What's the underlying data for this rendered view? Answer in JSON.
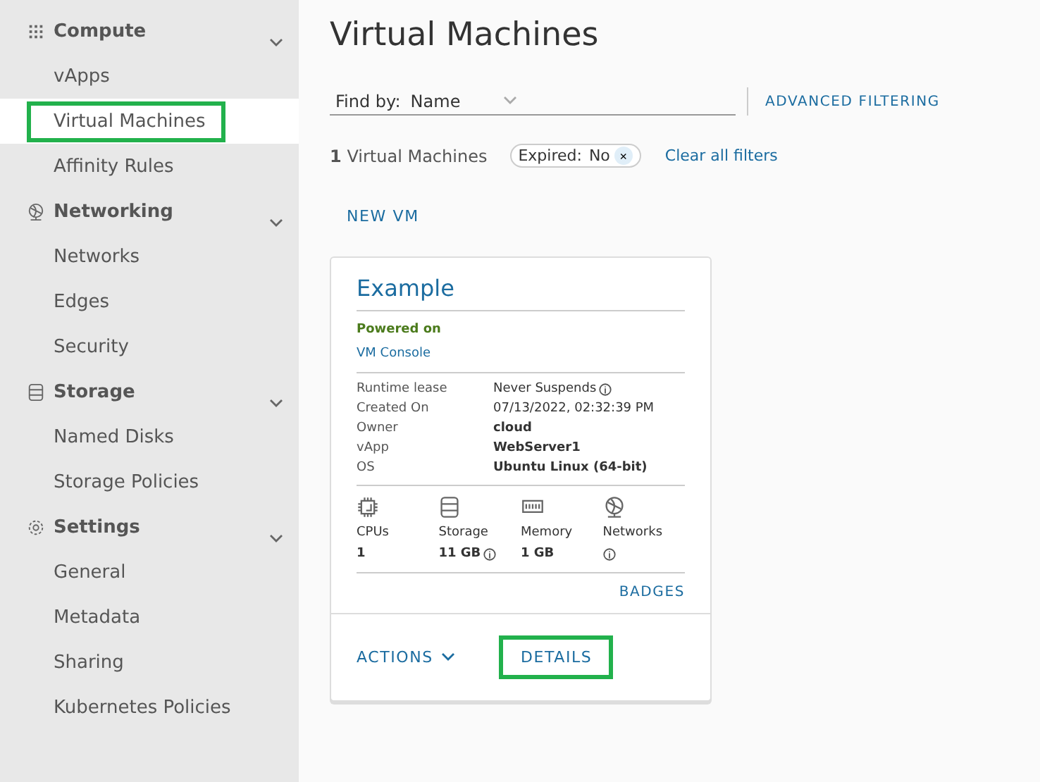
{
  "sidebar": {
    "sections": [
      {
        "label": "Compute",
        "expanded": true,
        "items": [
          {
            "label": "vApps",
            "selected": false,
            "highlighted": false
          },
          {
            "label": "Virtual Machines",
            "selected": true,
            "highlighted": true
          },
          {
            "label": "Affinity Rules",
            "selected": false,
            "highlighted": false
          }
        ]
      },
      {
        "label": "Networking",
        "expanded": true,
        "items": [
          {
            "label": "Networks",
            "selected": false,
            "highlighted": false
          },
          {
            "label": "Edges",
            "selected": false,
            "highlighted": false
          },
          {
            "label": "Security",
            "selected": false,
            "highlighted": false
          }
        ]
      },
      {
        "label": "Storage",
        "expanded": true,
        "items": [
          {
            "label": "Named Disks",
            "selected": false,
            "highlighted": false
          },
          {
            "label": "Storage Policies",
            "selected": false,
            "highlighted": false
          }
        ]
      },
      {
        "label": "Settings",
        "expanded": true,
        "items": [
          {
            "label": "General",
            "selected": false,
            "highlighted": false
          },
          {
            "label": "Metadata",
            "selected": false,
            "highlighted": false
          },
          {
            "label": "Sharing",
            "selected": false,
            "highlighted": false
          },
          {
            "label": "Kubernetes Policies",
            "selected": false,
            "highlighted": false
          }
        ]
      }
    ]
  },
  "page": {
    "title": "Virtual Machines",
    "find_by": {
      "label": "Find by:",
      "value": "Name"
    },
    "advanced_filtering": "ADVANCED FILTERING",
    "count": {
      "number": "1",
      "label": "Virtual Machines"
    },
    "filter_chip": {
      "label": "Expired:",
      "value": "No",
      "remove": "×"
    },
    "clear_filters": "Clear all filters",
    "new_vm": "NEW VM",
    "card": {
      "title": "Example",
      "status": "Powered on",
      "console": "VM Console",
      "properties": [
        {
          "label": "Runtime lease",
          "value": "Never Suspends",
          "bold": false,
          "info": true
        },
        {
          "label": "Created On",
          "value": "07/13/2022, 02:32:39 PM",
          "bold": false,
          "info": false
        },
        {
          "label": "Owner",
          "value": "cloud",
          "bold": true,
          "info": false
        },
        {
          "label": "vApp",
          "value": "WebServer1",
          "bold": true,
          "info": false
        },
        {
          "label": "OS",
          "value": "Ubuntu Linux (64-bit)",
          "bold": true,
          "info": false
        }
      ],
      "resources": [
        {
          "label": "CPUs",
          "value": "1",
          "info": false
        },
        {
          "label": "Storage",
          "value": "11 GB",
          "info": true
        },
        {
          "label": "Memory",
          "value": "1 GB",
          "info": false
        },
        {
          "label": "Networks",
          "info": true
        }
      ],
      "badges": "BADGES",
      "actions": "ACTIONS",
      "details": "DETAILS",
      "details_highlighted": true
    }
  }
}
